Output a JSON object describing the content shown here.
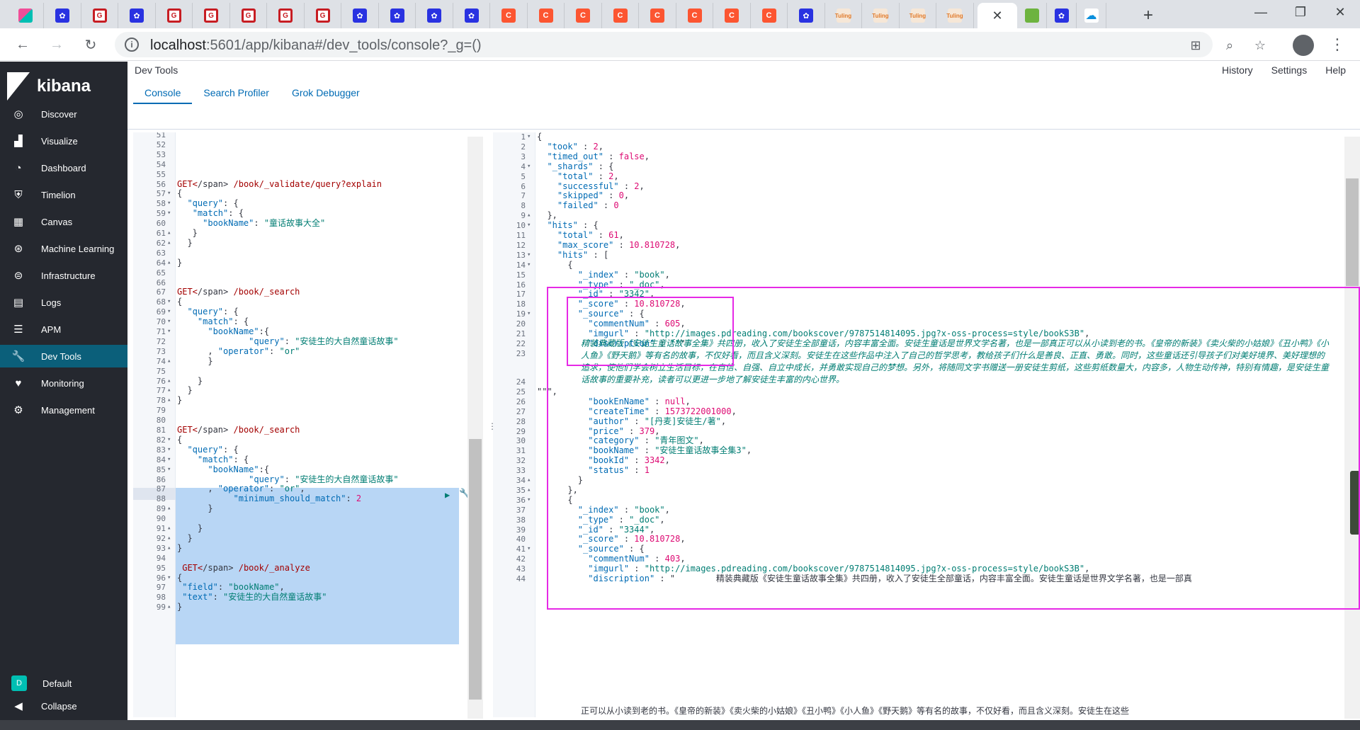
{
  "browser": {
    "url_host": "localhost",
    "url_rest": ":5601/app/kibana#/dev_tools/console?_g=()",
    "close_tab": "✕",
    "new_tab": "+",
    "tabs": [
      {
        "icon": "kibana-icon",
        "glyph": ""
      },
      {
        "icon": "baidu-paw-icon",
        "glyph": "✿"
      },
      {
        "icon": "gitee-icon",
        "glyph": "G"
      },
      {
        "icon": "baidu-paw-icon",
        "glyph": "✿"
      },
      {
        "icon": "gitee-icon",
        "glyph": "G"
      },
      {
        "icon": "gitee-icon",
        "glyph": "G"
      },
      {
        "icon": "gitee-icon",
        "glyph": "G"
      },
      {
        "icon": "gitee-icon",
        "glyph": "G"
      },
      {
        "icon": "gitee-icon",
        "glyph": "G"
      },
      {
        "icon": "baidu-paw-icon",
        "glyph": "✿"
      },
      {
        "icon": "baidu-paw-icon",
        "glyph": "✿"
      },
      {
        "icon": "baidu-paw-icon",
        "glyph": "✿"
      },
      {
        "icon": "baidu-paw-icon",
        "glyph": "✿"
      },
      {
        "icon": "csdn-icon",
        "glyph": "C"
      },
      {
        "icon": "csdn-icon",
        "glyph": "C"
      },
      {
        "icon": "csdn-icon",
        "glyph": "C"
      },
      {
        "icon": "csdn-icon",
        "glyph": "C"
      },
      {
        "icon": "csdn-icon",
        "glyph": "C"
      },
      {
        "icon": "csdn-icon",
        "glyph": "C"
      },
      {
        "icon": "csdn-icon",
        "glyph": "C"
      },
      {
        "icon": "csdn-icon",
        "glyph": "C"
      },
      {
        "icon": "baidu-paw-icon",
        "glyph": "✿"
      },
      {
        "icon": "tuling-icon",
        "glyph": "Tuling"
      },
      {
        "icon": "tuling-icon",
        "glyph": "Tuling"
      },
      {
        "icon": "tuling-icon",
        "glyph": "Tuling"
      },
      {
        "icon": "tuling-icon",
        "glyph": "Tuling"
      }
    ]
  },
  "kibana": {
    "brand": "kibana",
    "app_title": "Dev Tools",
    "top_links": [
      "History",
      "Settings",
      "Help"
    ],
    "subtabs": [
      "Console",
      "Search Profiler",
      "Grok Debugger"
    ],
    "nav": [
      {
        "label": "Discover",
        "icon": "compass-icon",
        "glyph": "◎"
      },
      {
        "label": "Visualize",
        "icon": "bar-chart-icon",
        "glyph": "▟"
      },
      {
        "label": "Dashboard",
        "icon": "dashboard-icon",
        "glyph": "◔"
      },
      {
        "label": "Timelion",
        "icon": "timelion-icon",
        "glyph": "⛨"
      },
      {
        "label": "Canvas",
        "icon": "canvas-icon",
        "glyph": "▦"
      },
      {
        "label": "Machine Learning",
        "icon": "ml-icon",
        "glyph": "⊛"
      },
      {
        "label": "Infrastructure",
        "icon": "infrastructure-icon",
        "glyph": "⊜"
      },
      {
        "label": "Logs",
        "icon": "logs-icon",
        "glyph": "▤"
      },
      {
        "label": "APM",
        "icon": "apm-icon",
        "glyph": "☰"
      },
      {
        "label": "Dev Tools",
        "icon": "wrench-icon",
        "glyph": "🔧"
      },
      {
        "label": "Monitoring",
        "icon": "heartbeat-icon",
        "glyph": "♥"
      },
      {
        "label": "Management",
        "icon": "gear-icon",
        "glyph": "⚙"
      }
    ],
    "space": {
      "badge": "D",
      "label": "Default"
    },
    "collapse": "Collapse"
  },
  "editor": {
    "lines": [
      {
        "n": "51",
        "f": "",
        "t": ""
      },
      {
        "n": "52",
        "f": "",
        "t": ""
      },
      {
        "n": "53",
        "f": "",
        "t": ""
      },
      {
        "n": "54",
        "f": "",
        "t": ""
      },
      {
        "n": "55",
        "f": "",
        "t": ""
      },
      {
        "n": "56",
        "f": "",
        "t": "GET /book/_validate/query?explain"
      },
      {
        "n": "57",
        "f": "▾",
        "t": "{"
      },
      {
        "n": "58",
        "f": "▾",
        "t": "  \"query\": {"
      },
      {
        "n": "59",
        "f": "▾",
        "t": "   \"match\": {"
      },
      {
        "n": "60",
        "f": "",
        "t": "     \"bookName\": \"童话故事大全\""
      },
      {
        "n": "61",
        "f": "▴",
        "t": "   }"
      },
      {
        "n": "62",
        "f": "▴",
        "t": "  }"
      },
      {
        "n": "63",
        "f": "",
        "t": ""
      },
      {
        "n": "64",
        "f": "▴",
        "t": "}"
      },
      {
        "n": "65",
        "f": "",
        "t": ""
      },
      {
        "n": "66",
        "f": "",
        "t": ""
      },
      {
        "n": "67",
        "f": "",
        "t": "GET /book/_search"
      },
      {
        "n": "68",
        "f": "▾",
        "t": "{"
      },
      {
        "n": "69",
        "f": "▾",
        "t": "  \"query\": {"
      },
      {
        "n": "70",
        "f": "▾",
        "t": "    \"match\": {"
      },
      {
        "n": "71",
        "f": "▾",
        "t": "      \"bookName\":{"
      },
      {
        "n": "72",
        "f": "",
        "t": "              \"query\": \"安徒生的大自然童话故事\""
      },
      {
        "n": "73",
        "f": "",
        "t": "      , \"operator\": \"or\""
      },
      {
        "n": "74",
        "f": "▴",
        "t": "      }"
      },
      {
        "n": "75",
        "f": "",
        "t": ""
      },
      {
        "n": "76",
        "f": "▴",
        "t": "    }"
      },
      {
        "n": "77",
        "f": "▴",
        "t": "  }"
      },
      {
        "n": "78",
        "f": "▴",
        "t": "}"
      },
      {
        "n": "79",
        "f": "",
        "t": ""
      },
      {
        "n": "80",
        "f": "",
        "t": ""
      },
      {
        "n": "81",
        "f": "",
        "t": "GET /book/_search"
      },
      {
        "n": "82",
        "f": "▾",
        "t": "{"
      },
      {
        "n": "83",
        "f": "▾",
        "t": "  \"query\": {"
      },
      {
        "n": "84",
        "f": "▾",
        "t": "    \"match\": {"
      },
      {
        "n": "85",
        "f": "▾",
        "t": "      \"bookName\":{"
      },
      {
        "n": "86",
        "f": "",
        "t": "              \"query\": \"安徒生的大自然童话故事\""
      },
      {
        "n": "87",
        "f": "",
        "t": "      , \"operator\": \"or\","
      },
      {
        "n": "88",
        "f": "",
        "t": "           \"minimum_should_match\": 2"
      },
      {
        "n": "89",
        "f": "▴",
        "t": "      }"
      },
      {
        "n": "90",
        "f": "",
        "t": ""
      },
      {
        "n": "91",
        "f": "▴",
        "t": "    }"
      },
      {
        "n": "92",
        "f": "▴",
        "t": "  }"
      },
      {
        "n": "93",
        "f": "▴",
        "t": "}"
      },
      {
        "n": "94",
        "f": "",
        "t": ""
      },
      {
        "n": "95",
        "f": "",
        "t": " GET /book/_analyze"
      },
      {
        "n": "96",
        "f": "▾",
        "t": "{"
      },
      {
        "n": "97",
        "f": "",
        "t": " \"field\": \"bookName\","
      },
      {
        "n": "98",
        "f": "",
        "t": " \"text\": \"安徒生的大自然童话故事\""
      },
      {
        "n": "99",
        "f": "▴",
        "t": "}"
      }
    ]
  },
  "output": {
    "lines": [
      {
        "n": "1",
        "f": "▾",
        "t": "{"
      },
      {
        "n": "2",
        "f": "",
        "t": "  \"took\" : 2,"
      },
      {
        "n": "3",
        "f": "",
        "t": "  \"timed_out\" : false,"
      },
      {
        "n": "4",
        "f": "▾",
        "t": "  \"_shards\" : {"
      },
      {
        "n": "5",
        "f": "",
        "t": "    \"total\" : 2,"
      },
      {
        "n": "6",
        "f": "",
        "t": "    \"successful\" : 2,"
      },
      {
        "n": "7",
        "f": "",
        "t": "    \"skipped\" : 0,"
      },
      {
        "n": "8",
        "f": "",
        "t": "    \"failed\" : 0"
      },
      {
        "n": "9",
        "f": "▴",
        "t": "  },"
      },
      {
        "n": "10",
        "f": "▾",
        "t": "  \"hits\" : {"
      },
      {
        "n": "11",
        "f": "",
        "t": "    \"total\" : 61,"
      },
      {
        "n": "12",
        "f": "",
        "t": "    \"max_score\" : 10.810728,"
      },
      {
        "n": "13",
        "f": "▾",
        "t": "    \"hits\" : ["
      },
      {
        "n": "14",
        "f": "▾",
        "t": "      {"
      },
      {
        "n": "15",
        "f": "",
        "t": "        \"_index\" : \"book\","
      },
      {
        "n": "16",
        "f": "",
        "t": "        \"_type\" : \"_doc\","
      },
      {
        "n": "17",
        "f": "",
        "t": "        \"_id\" : \"3342\","
      },
      {
        "n": "18",
        "f": "",
        "t": "        \"_score\" : 10.810728,"
      },
      {
        "n": "19",
        "f": "▾",
        "t": "        \"_source\" : {"
      },
      {
        "n": "20",
        "f": "",
        "t": "          \"commentNum\" : 605,"
      },
      {
        "n": "21",
        "f": "",
        "t": "          \"imgurl\" : \"http://images.pdreading.com/bookscover/9787514814095.jpg?x-oss-process=style/bookS3B\","
      },
      {
        "n": "22",
        "f": "",
        "t": "          \"discription\" : \"\"\""
      },
      {
        "n": "23",
        "f": "",
        "t": ""
      },
      {
        "n": "24",
        "f": "",
        "t": ""
      },
      {
        "n": "25",
        "f": "",
        "t": "\"\"\","
      },
      {
        "n": "26",
        "f": "",
        "t": "          \"bookEnName\" : null,"
      },
      {
        "n": "27",
        "f": "",
        "t": "          \"createTime\" : 1573722001000,"
      },
      {
        "n": "28",
        "f": "",
        "t": "          \"author\" : \"[丹麦]安徒生/著\","
      },
      {
        "n": "29",
        "f": "",
        "t": "          \"price\" : 379,"
      },
      {
        "n": "30",
        "f": "",
        "t": "          \"category\" : \"青年图文\","
      },
      {
        "n": "31",
        "f": "",
        "t": "          \"bookName\" : \"安徒生童话故事全集3\","
      },
      {
        "n": "32",
        "f": "",
        "t": "          \"bookId\" : 3342,"
      },
      {
        "n": "33",
        "f": "",
        "t": "          \"status\" : 1"
      },
      {
        "n": "34",
        "f": "▴",
        "t": "        }"
      },
      {
        "n": "35",
        "f": "▴",
        "t": "      },"
      },
      {
        "n": "36",
        "f": "▾",
        "t": "      {"
      },
      {
        "n": "37",
        "f": "",
        "t": "        \"_index\" : \"book\","
      },
      {
        "n": "38",
        "f": "",
        "t": "        \"_type\" : \"_doc\","
      },
      {
        "n": "39",
        "f": "",
        "t": "        \"_id\" : \"3344\","
      },
      {
        "n": "40",
        "f": "",
        "t": "        \"_score\" : 10.810728,"
      },
      {
        "n": "41",
        "f": "▾",
        "t": "        \"_source\" : {"
      },
      {
        "n": "42",
        "f": "",
        "t": "          \"commentNum\" : 403,"
      },
      {
        "n": "43",
        "f": "",
        "t": "          \"imgurl\" : \"http://images.pdreading.com/bookscover/9787514814095.jpg?x-oss-process=style/bookS3B\","
      },
      {
        "n": "44",
        "f": "",
        "t": "          \"discription\" : \"        精装典藏版《安徒生童话故事全集》共四册，收入了安徒生全部童话，内容丰富全面。安徒生童话是世界文学名著，也是一部真"
      }
    ],
    "description": "精装典藏版《安徒生童话故事全集》共四册，收入了安徒生全部童话，内容丰富全面。安徒生童话是世界文学名著，也是一部真正可以从小读到老的书。《皇帝的新装》《卖火柴的小姑娘》《丑小鸭》《小人鱼》《野天鹅》等有名的故事，不仅好看，而且含义深刻。安徒生在这些作品中注入了自己的哲学思考，教给孩子们什么是善良、正直、勇敢。同时，这些童话还引导孩子们对美好境界、美好理想的追求，使他们学会树立生活目标，在自信、自强、自立中成长，并勇敢实现自己的梦想。另外，将随同文字书赠送一册安徒生剪纸，这些剪纸数量大，内容多，人物生动传神，特别有情趣，是安徒生童话故事的重要补充，读者可以更进一步地了解安徒生丰富的内心世界。",
    "overflow_line": "正可以从小读到老的书。《皇帝的新装》《卖火柴的小姑娘》《丑小鸭》《小人鱼》《野天鹅》等有名的故事，不仅好看，而且含义深刻。安徒生在这些"
  },
  "colors": {
    "sidebar": "#25282f",
    "accent": "#006bb4",
    "selection": "#b8d6f5",
    "annotation": "#e629e6"
  }
}
